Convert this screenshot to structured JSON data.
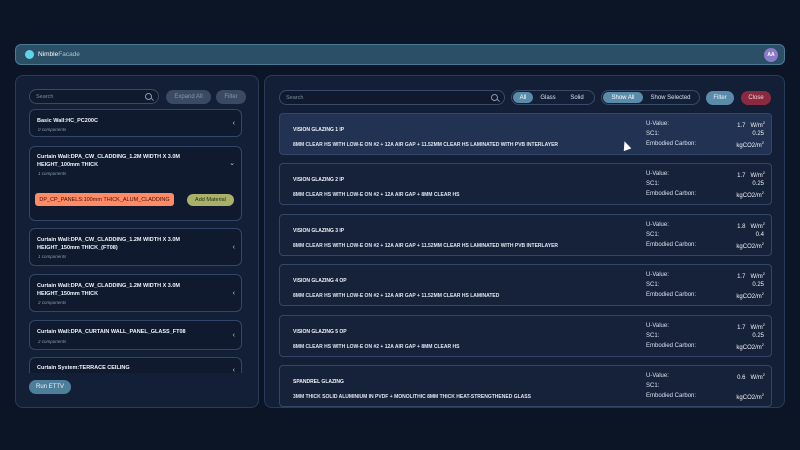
{
  "app": {
    "brand_part1": "Nimble",
    "brand_part2": "Facade",
    "avatar_initials": "AA",
    "accent_color": "#5a8ba8"
  },
  "left": {
    "search_placeholder": "Search",
    "expand_all_label": "Expand All",
    "filter_label": "Filter",
    "run_label": "Run ETTV",
    "components": [
      {
        "title": "Basic Wall:HC_PC200C",
        "subtitle": "0 components",
        "expanded": false
      },
      {
        "title": "Curtain Wall:DPA_CW_CLADDING_1.2M WIDTH X 3.0M HEIGHT_100mm THICK",
        "subtitle": "1 components",
        "expanded": true,
        "material_tag": "DP_CP_PANELS:100mm THICK_ALUM_CLADDING",
        "add_material_label": "Add Material"
      },
      {
        "title": "Curtain Wall:DPA_CW_CLADDING_1.2M WIDTH X 3.0M HEIGHT_150mm THICK_(FT08)",
        "subtitle": "1 components",
        "expanded": false
      },
      {
        "title": "Curtain Wall:DPA_CW_CLADDING_1.2M WIDTH X 3.0M HEIGHT_150mm THICK",
        "subtitle": "2 components",
        "expanded": false
      },
      {
        "title": "Curtain Wall:DPA_CURTAIN WALL_PANEL_GLASS_FT08",
        "subtitle": "2 components",
        "expanded": false
      },
      {
        "title": "Curtain System:TERRACE CEILING",
        "subtitle": "",
        "expanded": false
      }
    ]
  },
  "right": {
    "search_placeholder": "Search",
    "type_filters": [
      "All",
      "Glass",
      "Solid"
    ],
    "active_type_filter": "All",
    "view_filters": [
      "Show All",
      "Show Selected"
    ],
    "active_view_filter": "Show All",
    "filter_label": "Filter",
    "close_label": "Close",
    "prop_labels": {
      "u": "U-Value:",
      "sc": "SC1:",
      "carbon": "Embodied Carbon:"
    },
    "u_unit": "W/m",
    "carbon_unit": "kgCO2/m",
    "unit_exponent": "2",
    "materials": [
      {
        "name": "VISION GLAZING 1 IP",
        "desc": "8MM CLEAR HS WITH LOW-E ON #2 + 12A AIR GAP + 11.52MM CLEAR HS LAMINATED WITH PVB INTERLAYER",
        "u": "1.7",
        "sc": "0.25"
      },
      {
        "name": "VISION GLAZING 2 IP",
        "desc": "8MM CLEAR HS WITH LOW-E ON #2 + 12A AIR GAP + 8MM CLEAR HS",
        "u": "1.7",
        "sc": "0.25"
      },
      {
        "name": "VISION GLAZING 3 IP",
        "desc": "8MM CLEAR HS WITH LOW-E ON #2 + 12A AIR GAP + 11.52MM CLEAR HS LAMINATED WITH PVB INTERLAYER",
        "u": "1.8",
        "sc": "0.4"
      },
      {
        "name": "VISION GLAZING 4 OP",
        "desc": "8MM CLEAR HS WITH LOW-E ON #2 + 12A AIR GAP + 11.52MM CLEAR HS LAMINATED",
        "u": "1.7",
        "sc": "0.25"
      },
      {
        "name": "VISION GLAZING 5 OP",
        "desc": "8MM CLEAR HS WITH LOW-E ON #2 + 12A AIR GAP + 8MM CLEAR HS",
        "u": "1.7",
        "sc": "0.25"
      },
      {
        "name": "SPANDREL GLAZING",
        "desc": "3MM THICK SOLID ALUMINIUM IN PVDF + MONOLITHIC 8MM THICK HEAT-STRENGTHENED GLASS",
        "u": "0.6",
        "sc": ""
      }
    ]
  }
}
